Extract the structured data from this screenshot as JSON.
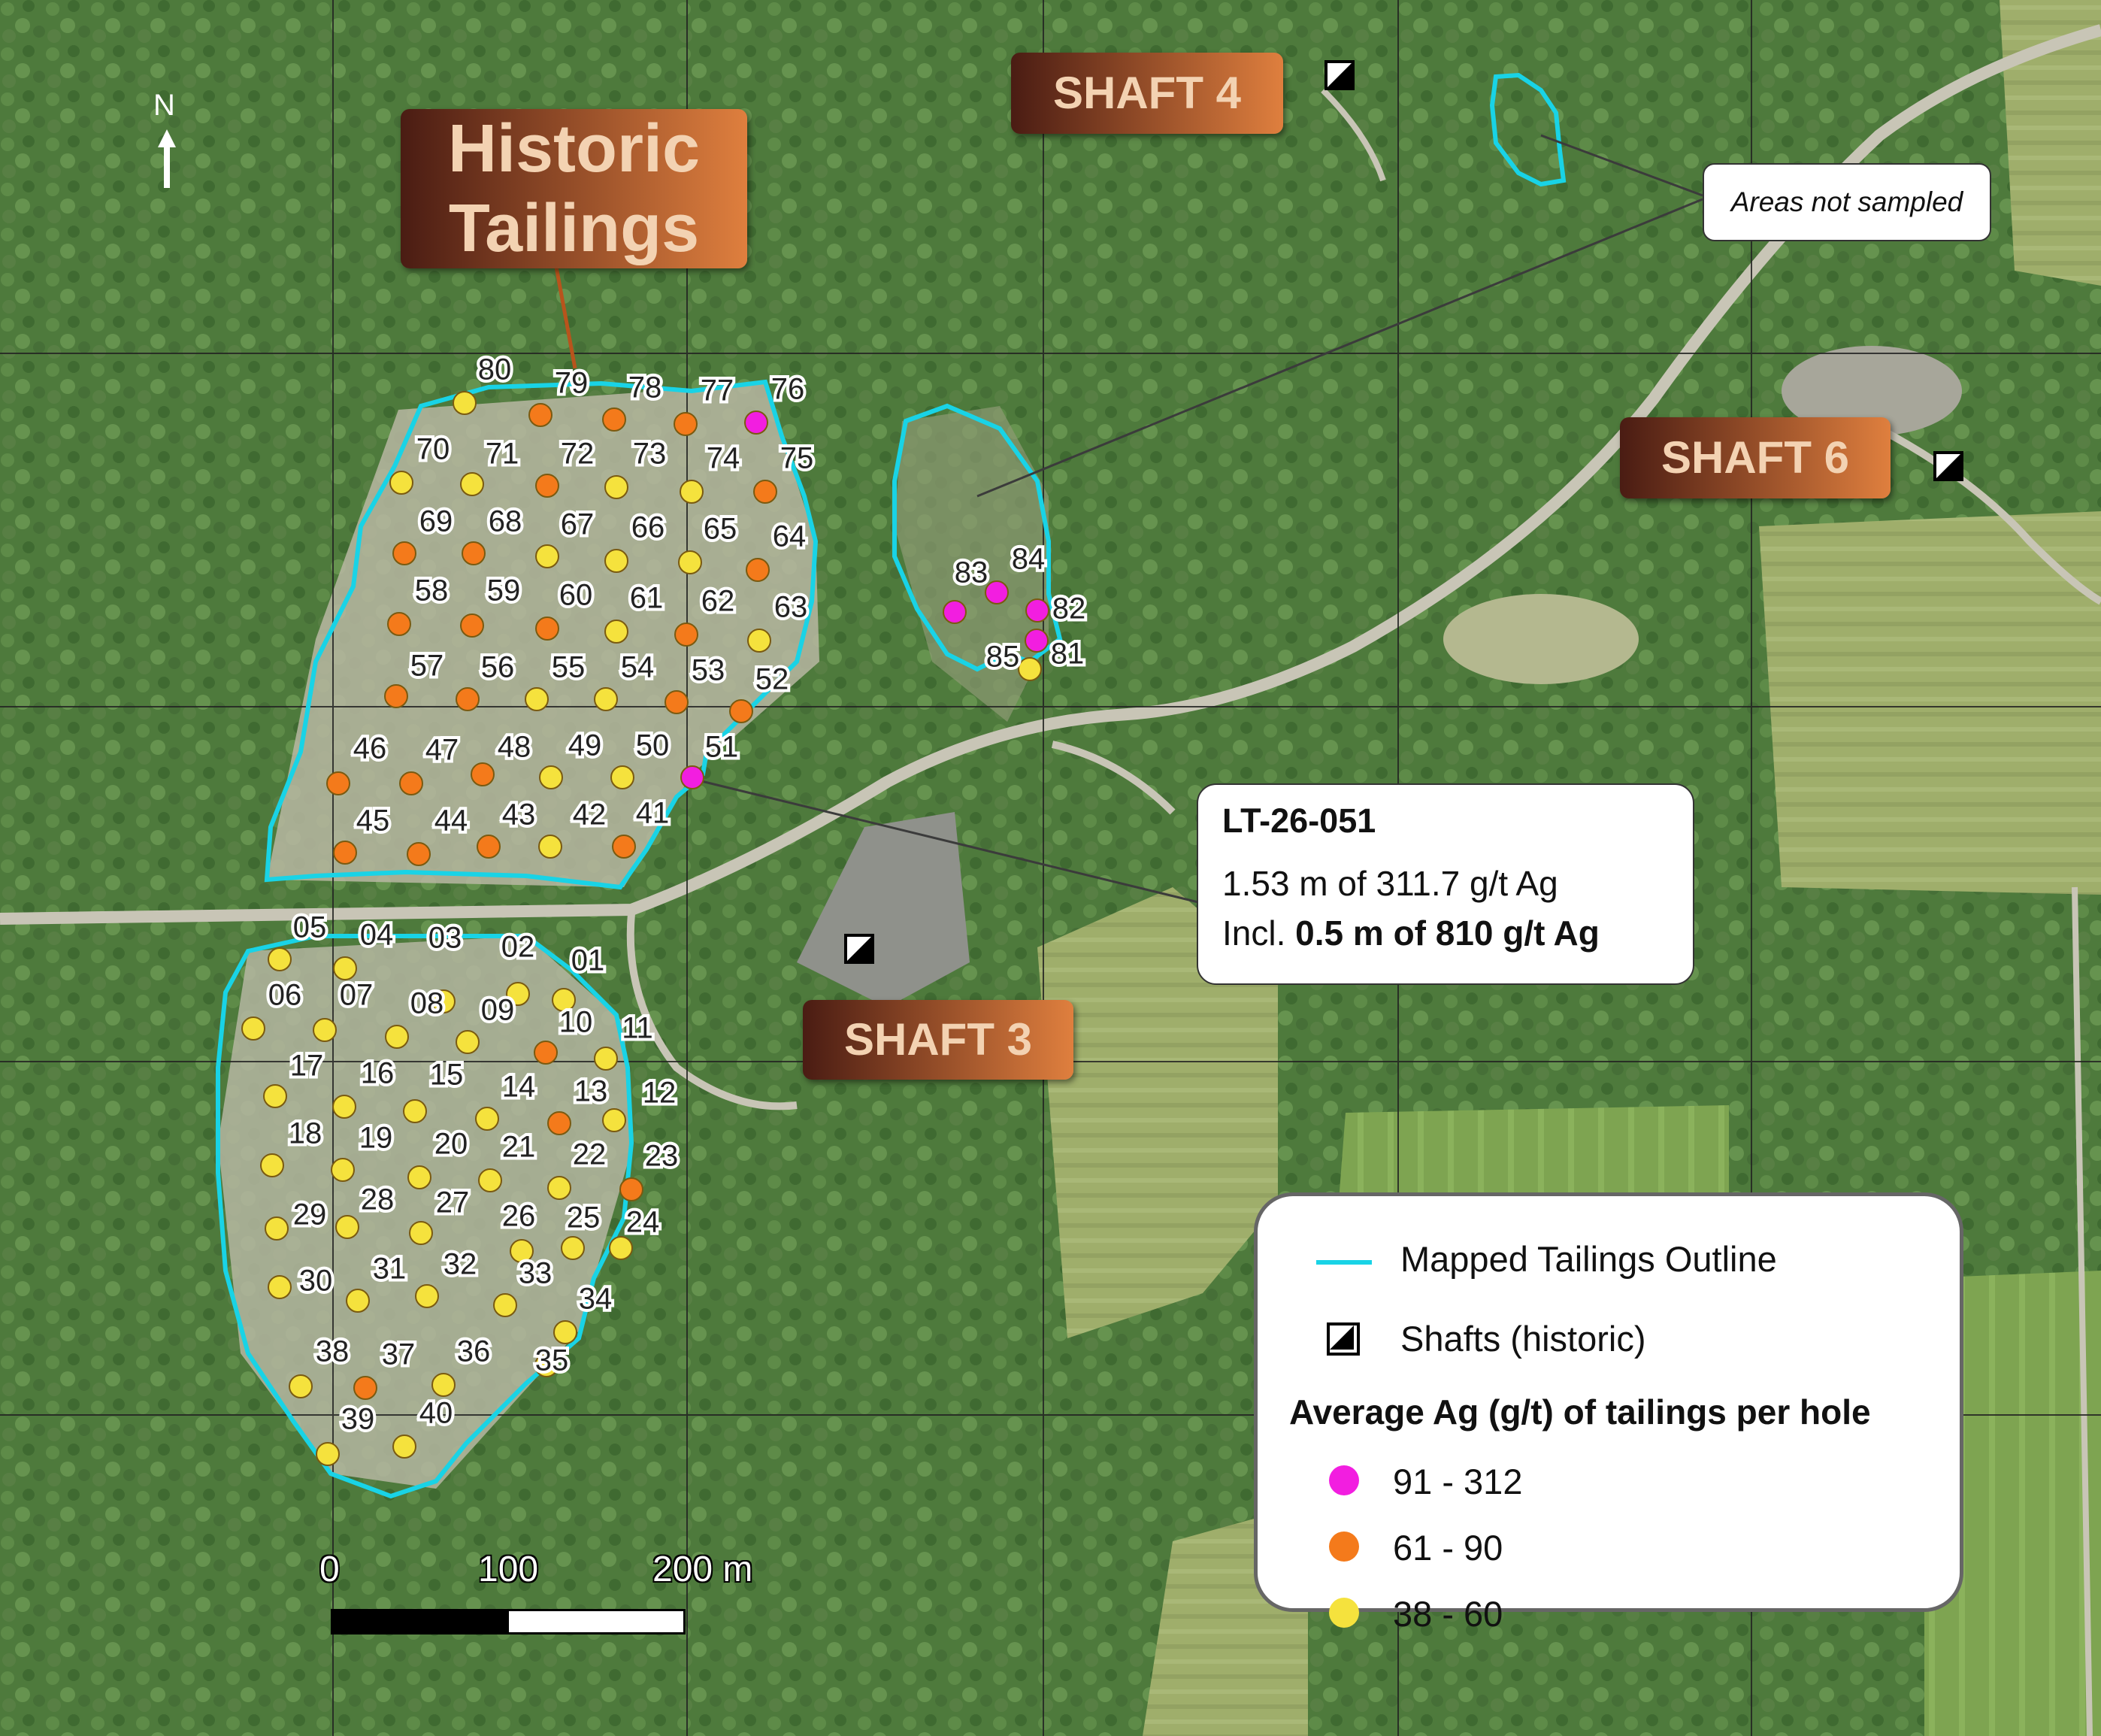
{
  "colors": {
    "outline": "#19d3e6",
    "high": "#f21ee0",
    "mid": "#f47a1b",
    "low": "#f5e23d",
    "banner_from": "#4a1c13",
    "banner_to": "#df7f3e"
  },
  "north_label": "N",
  "historic_tailings": {
    "line1": "Historic",
    "line2": "Tailings"
  },
  "shafts": {
    "shaft3": "SHAFT 3",
    "shaft4": "SHAFT 4",
    "shaft6": "SHAFT 6"
  },
  "areas_not_sampled": "Areas not sampled",
  "drillhole_callout": {
    "hole_id": "LT-26-051",
    "result": "1.53 m of 311.7 g/t Ag",
    "incl_prefix": "Incl.",
    "incl_value": "0.5 m of 810 g/t Ag"
  },
  "legend": {
    "outline_label": "Mapped Tailings Outline",
    "shaft_label": "Shafts (historic)",
    "heading": "Average Ag (g/t) of tailings per hole",
    "classes": [
      {
        "label": "91 - 312",
        "class": "high"
      },
      {
        "label": "61 - 90",
        "class": "mid"
      },
      {
        "label": "38 - 60",
        "class": "low"
      }
    ]
  },
  "scale": {
    "labels": [
      "0",
      "100",
      "200 m"
    ]
  },
  "sample_points": [
    {
      "id": "01",
      "grade": "low"
    },
    {
      "id": "02",
      "grade": "low"
    },
    {
      "id": "03",
      "grade": "low"
    },
    {
      "id": "04",
      "grade": "low"
    },
    {
      "id": "05",
      "grade": "low"
    },
    {
      "id": "06",
      "grade": "low"
    },
    {
      "id": "07",
      "grade": "low"
    },
    {
      "id": "08",
      "grade": "low"
    },
    {
      "id": "09",
      "grade": "low"
    },
    {
      "id": "10",
      "grade": "mid"
    },
    {
      "id": "11",
      "grade": "low"
    },
    {
      "id": "12",
      "grade": "low"
    },
    {
      "id": "13",
      "grade": "mid"
    },
    {
      "id": "14",
      "grade": "low"
    },
    {
      "id": "15",
      "grade": "low"
    },
    {
      "id": "16",
      "grade": "low"
    },
    {
      "id": "17",
      "grade": "low"
    },
    {
      "id": "18",
      "grade": "low"
    },
    {
      "id": "19",
      "grade": "low"
    },
    {
      "id": "20",
      "grade": "low"
    },
    {
      "id": "21",
      "grade": "low"
    },
    {
      "id": "22",
      "grade": "low"
    },
    {
      "id": "23",
      "grade": "mid"
    },
    {
      "id": "24",
      "grade": "low"
    },
    {
      "id": "25",
      "grade": "low"
    },
    {
      "id": "26",
      "grade": "low"
    },
    {
      "id": "27",
      "grade": "low"
    },
    {
      "id": "28",
      "grade": "low"
    },
    {
      "id": "29",
      "grade": "low"
    },
    {
      "id": "30",
      "grade": "low"
    },
    {
      "id": "31",
      "grade": "low"
    },
    {
      "id": "32",
      "grade": "low"
    },
    {
      "id": "33",
      "grade": "low"
    },
    {
      "id": "34",
      "grade": "low"
    },
    {
      "id": "35",
      "grade": "low"
    },
    {
      "id": "36",
      "grade": "low"
    },
    {
      "id": "37",
      "grade": "mid"
    },
    {
      "id": "38",
      "grade": "low"
    },
    {
      "id": "39",
      "grade": "low"
    },
    {
      "id": "40",
      "grade": "low"
    },
    {
      "id": "41",
      "grade": "mid"
    },
    {
      "id": "42",
      "grade": "low"
    },
    {
      "id": "43",
      "grade": "mid"
    },
    {
      "id": "44",
      "grade": "mid"
    },
    {
      "id": "45",
      "grade": "mid"
    },
    {
      "id": "46",
      "grade": "mid"
    },
    {
      "id": "47",
      "grade": "mid"
    },
    {
      "id": "48",
      "grade": "mid"
    },
    {
      "id": "49",
      "grade": "low"
    },
    {
      "id": "50",
      "grade": "low"
    },
    {
      "id": "51",
      "grade": "high"
    },
    {
      "id": "52",
      "grade": "mid"
    },
    {
      "id": "53",
      "grade": "mid"
    },
    {
      "id": "54",
      "grade": "low"
    },
    {
      "id": "55",
      "grade": "low"
    },
    {
      "id": "56",
      "grade": "mid"
    },
    {
      "id": "57",
      "grade": "mid"
    },
    {
      "id": "58",
      "grade": "mid"
    },
    {
      "id": "59",
      "grade": "mid"
    },
    {
      "id": "60",
      "grade": "mid"
    },
    {
      "id": "61",
      "grade": "low"
    },
    {
      "id": "62",
      "grade": "mid"
    },
    {
      "id": "63",
      "grade": "low"
    },
    {
      "id": "64",
      "grade": "mid"
    },
    {
      "id": "65",
      "grade": "low"
    },
    {
      "id": "66",
      "grade": "low"
    },
    {
      "id": "67",
      "grade": "low"
    },
    {
      "id": "68",
      "grade": "mid"
    },
    {
      "id": "69",
      "grade": "mid"
    },
    {
      "id": "70",
      "grade": "low"
    },
    {
      "id": "71",
      "grade": "low"
    },
    {
      "id": "72",
      "grade": "mid"
    },
    {
      "id": "73",
      "grade": "low"
    },
    {
      "id": "74",
      "grade": "low"
    },
    {
      "id": "75",
      "grade": "mid"
    },
    {
      "id": "76",
      "grade": "high"
    },
    {
      "id": "77",
      "grade": "mid"
    },
    {
      "id": "78",
      "grade": "mid"
    },
    {
      "id": "79",
      "grade": "mid"
    },
    {
      "id": "80",
      "grade": "low"
    },
    {
      "id": "81",
      "grade": "high"
    },
    {
      "id": "82",
      "grade": "high"
    },
    {
      "id": "83",
      "grade": "high"
    },
    {
      "id": "84",
      "grade": "high"
    },
    {
      "id": "85",
      "grade": "low"
    }
  ]
}
